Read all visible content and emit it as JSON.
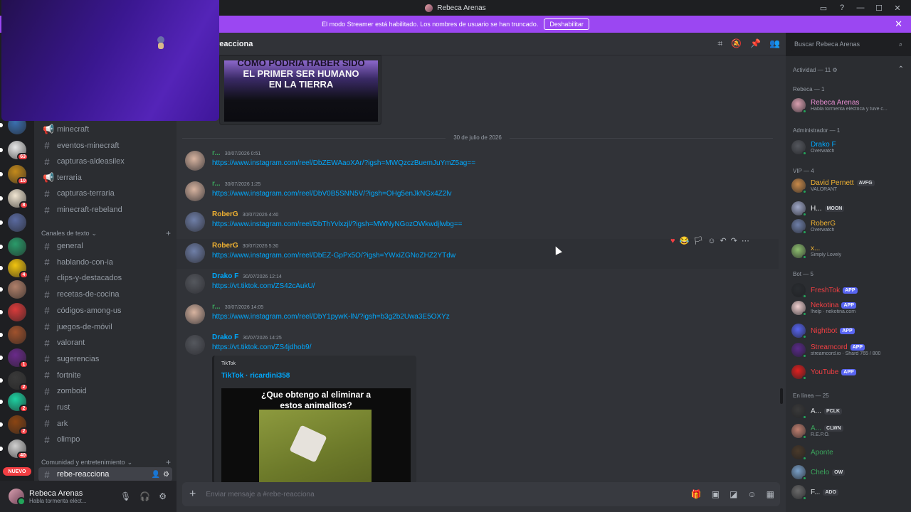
{
  "window": {
    "title": "Rebeca Arenas"
  },
  "banner": {
    "text": "El modo Streamer está habilitado. Los nombres de usuario se han truncado.",
    "button": "Deshabilitar"
  },
  "servers": [
    {
      "color": "#3b6fb0",
      "badge": ""
    },
    {
      "color": "#e8e8e8",
      "badge": "63"
    },
    {
      "color": "#c48a1c",
      "badge": "10"
    },
    {
      "color": "#f1e6d2",
      "badge": "8"
    },
    {
      "color": "#5a6aa0",
      "badge": ""
    },
    {
      "color": "#2a9b6a",
      "badge": ""
    },
    {
      "color": "#f1c40f",
      "badge": "4"
    },
    {
      "color": "#b0806a",
      "badge": ""
    },
    {
      "color": "#d93b3b",
      "badge": ""
    },
    {
      "color": "#a0522d",
      "badge": ""
    },
    {
      "color": "#6a2a8a",
      "badge": "1"
    },
    {
      "color": "#3a3a3a",
      "badge": "2"
    },
    {
      "color": "#1dd1a1",
      "badge": "2"
    },
    {
      "color": "#8b4513",
      "badge": "2"
    },
    {
      "color": "#d0d0d0",
      "badge": "40"
    }
  ],
  "nuevo_label": "NUEVO",
  "channels": {
    "top": [
      {
        "name": "minecraft",
        "icon": "📢"
      },
      {
        "name": "eventos-minecraft",
        "icon": "#"
      },
      {
        "name": "capturas-aldeasilex",
        "icon": "#"
      },
      {
        "name": "terraria",
        "icon": "📢"
      },
      {
        "name": "capturas-terraria",
        "icon": "#"
      },
      {
        "name": "minecraft-rebeland",
        "icon": "#"
      }
    ],
    "category1": "Canales de texto",
    "text": [
      "general",
      "hablando-con-ia",
      "clips-y-destacados",
      "recetas-de-cocina",
      "códigos-among-us",
      "juegos-de-móvil",
      "valorant",
      "sugerencias",
      "fortnite",
      "zomboid",
      "rust",
      "ark",
      "olimpo"
    ],
    "category2": "Comunidad y entretenimiento",
    "active": "rebe-reacciona"
  },
  "user": {
    "name": "Rebeca Arenas",
    "status": "Habla tormenta eléct..."
  },
  "channel_header": {
    "title": "reacciona"
  },
  "search": {
    "placeholder": "Buscar Rebeca Arenas"
  },
  "preview": {
    "line1": "COMO PODRÍA HABER SIDO",
    "line2": "EL PRIMER SER HUMANO",
    "line3": "EN LA TIERRA"
  },
  "date_separator": "30 de julio de 2026",
  "messages": [
    {
      "name": "r...",
      "color": "#3ba55c",
      "time": "30/07/2026 0:51",
      "link": "https://www.instagram.com/reel/DbZEWAaoXAr/?igsh=MWQzczBuemJuYmZ5ag=="
    },
    {
      "name": "r...",
      "color": "#3ba55c",
      "time": "30/07/2026 1:25",
      "link": "https://www.instagram.com/reel/DbV0B5SNN5V/?igsh=OHg5enJkNGx4Z2lv"
    },
    {
      "name": "RoberG",
      "color": "#f0b232",
      "time": "30/07/2026 4:40",
      "link": "https://www.instagram.com/reel/DbThYvlxzjl/?igsh=MWNyNGozOWkwdjlwbg=="
    },
    {
      "name": "RoberG",
      "color": "#f0b232",
      "time": "30/07/2026 5:30",
      "link": "https://www.instagram.com/reel/DbEZ-GpPx5O/?igsh=YWxiZGNoZHZ2YTdw"
    },
    {
      "name": "Drako F",
      "color": "#00a8fc",
      "time": "30/07/2026 12:14",
      "link": "https://vt.tiktok.com/ZS42cAukU/"
    },
    {
      "name": "r...",
      "color": "#3ba55c",
      "time": "30/07/2026 14:05",
      "link": "https://www.instagram.com/reel/DbY1pywK-lN/?igsh=b3g2b2Uwa3E5OXYz"
    },
    {
      "name": "Drako F",
      "color": "#00a8fc",
      "time": "30/07/2026 14:25",
      "link": "https://vt.tiktok.com/ZS4jdhob9/"
    }
  ],
  "embed": {
    "provider": "TikTok",
    "title": "TikTok · ricardini358",
    "video_text": "¿Que obtengo al eliminar a estos animalitos?"
  },
  "composer": {
    "placeholder": "Enviar mensaje a #rebe-reacciona"
  },
  "members": {
    "activity": "Actividad — 11",
    "groups": [
      {
        "title": "Rebeca — 1",
        "items": [
          {
            "name": "Rebeca Arenas",
            "color": "#e78fd1",
            "sub": "Habla tormenta eléctrica y tuve c...",
            "tag": ""
          }
        ]
      },
      {
        "title": "Administrador — 1",
        "items": [
          {
            "name": "Drako F",
            "color": "#00a8fc",
            "sub": "Overwatch",
            "tag": ""
          }
        ]
      },
      {
        "title": "VIP — 4",
        "items": [
          {
            "name": "David Pernett",
            "color": "#f0b232",
            "sub": "VALORANT",
            "tag": "AVFG"
          },
          {
            "name": "H...",
            "color": "#f2f3f5",
            "sub": "",
            "tag": "MOON"
          },
          {
            "name": "RoberG",
            "color": "#f0b232",
            "sub": "Overwatch",
            "tag": ""
          },
          {
            "name": "x...",
            "color": "#f0b232",
            "sub": "Simply Lovely",
            "tag": ""
          }
        ]
      },
      {
        "title": "Bot — 5",
        "items": [
          {
            "name": "FreshTok",
            "color": "#f23f43",
            "sub": "",
            "tag": "APP"
          },
          {
            "name": "Nekotina",
            "color": "#f23f43",
            "sub": "!help · nekotina.com",
            "tag": "APP"
          },
          {
            "name": "Nightbot",
            "color": "#f23f43",
            "sub": "",
            "tag": "APP"
          },
          {
            "name": "Streamcord",
            "color": "#f23f43",
            "sub": "streamcord.io · Shard 765 / 800",
            "tag": "APP"
          },
          {
            "name": "YouTube",
            "color": "#f23f43",
            "sub": "",
            "tag": "APP"
          }
        ]
      },
      {
        "title": "En línea — 25",
        "items": [
          {
            "name": "A...",
            "color": "#dbdee1",
            "sub": "",
            "tag": "PCLK"
          },
          {
            "name": "A...",
            "color": "#3ba55c",
            "sub": "R.E.P.O.",
            "tag": "CLWN"
          },
          {
            "name": "Aponte",
            "color": "#3ba55c",
            "sub": "",
            "tag": ""
          },
          {
            "name": "Chelo",
            "color": "#3ba55c",
            "sub": "",
            "tag": "OW"
          },
          {
            "name": "F...",
            "color": "#dbdee1",
            "sub": "",
            "tag": "ADO"
          }
        ]
      }
    ]
  }
}
